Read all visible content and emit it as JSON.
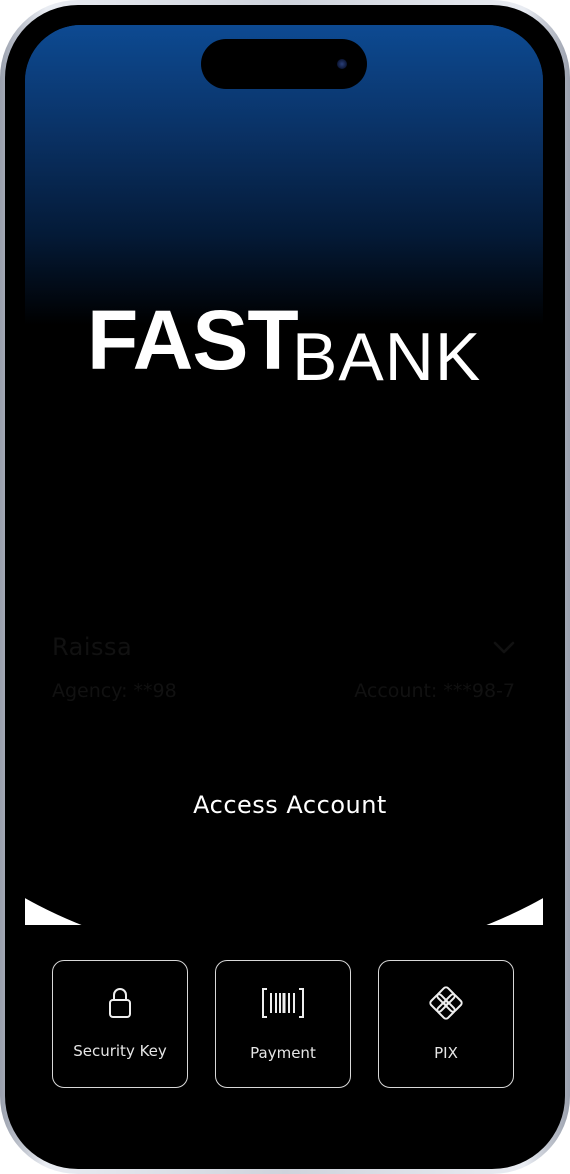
{
  "app": {
    "logo_bold": "FAST",
    "logo_light": "BANK"
  },
  "profile": {
    "name": "Raissa",
    "agency": "Agency: **98",
    "account": "Account: ***98-7"
  },
  "actions": {
    "access_label": "Access Account"
  },
  "shortcuts": [
    {
      "label": "Security Key",
      "icon": "lock-icon"
    },
    {
      "label": "Payment",
      "icon": "barcode-icon"
    },
    {
      "label": "PIX",
      "icon": "pix-icon"
    }
  ],
  "colors": {
    "hero_top": "#0d4a92",
    "background": "#000000",
    "panel": "#ffffff",
    "text": "#111111"
  }
}
